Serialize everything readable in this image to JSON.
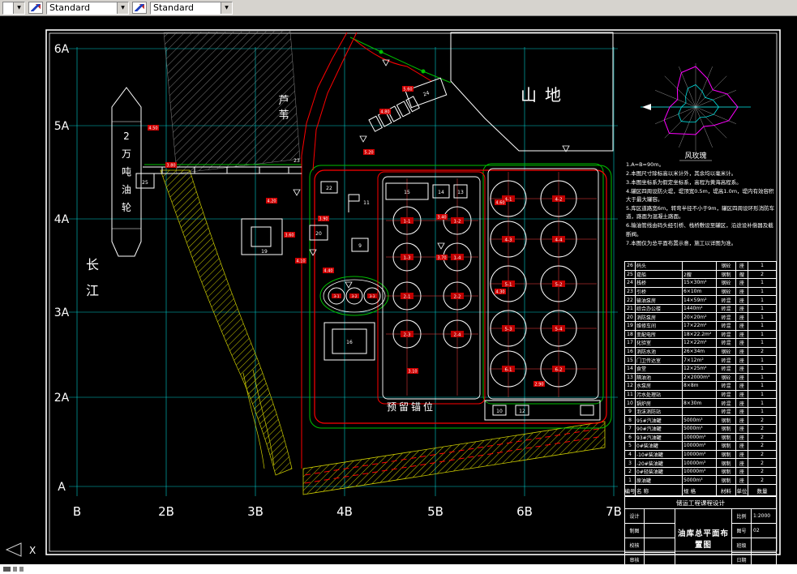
{
  "icons": {
    "dropdown": "▼"
  },
  "toolbar": {
    "combo1": "Standard",
    "combo2": "Standard"
  },
  "grid": {
    "rows": [
      "6A",
      "5A",
      "4A",
      "3A",
      "2A",
      "A"
    ],
    "cols": [
      "B",
      "2B",
      "3B",
      "4B",
      "5B",
      "6B",
      "7B"
    ]
  },
  "plan": {
    "river": [
      "长",
      "江"
    ],
    "ship": [
      "2",
      "万",
      "吨",
      "油",
      "轮"
    ],
    "reeds": [
      "芦",
      "苇"
    ],
    "mountain": "山地",
    "reserved": "预留锚位",
    "windrose_title": "风玫瑰",
    "buildings": {
      "n25": "25",
      "n24": "24",
      "n23": "23",
      "n22": "22",
      "n20": "20",
      "n19": "19",
      "n16": "16",
      "n15": "15",
      "n14": "14",
      "n13": "13",
      "n12": "12",
      "n11": "11",
      "n10": "10",
      "n9": "9"
    },
    "tanks_right": [
      "4-1",
      "4-2",
      "4-3",
      "4-4",
      "5-1",
      "5-2",
      "5-3",
      "5-4",
      "6-1",
      "6-2"
    ],
    "tanks_mid": [
      "1-1",
      "1-2",
      "1-3",
      "1-4",
      "2-1",
      "2-2",
      "2-3",
      "2-4"
    ],
    "tanks_small": [
      "3-1",
      "3-2",
      "3-3"
    ],
    "dims": [
      "4.50",
      "3.80",
      "4.20",
      "3.60",
      "4.10",
      "3.90",
      "4.40",
      "5.20",
      "4.80",
      "5.60",
      "3.40",
      "3.70",
      "4.60",
      "4.30",
      "2.90",
      "3.10"
    ]
  },
  "notes": {
    "lines": [
      "1.A=B=90m。",
      "2.本图尺寸除标高以米计外，其余均以毫米计。",
      "3.本图坐标系为假定坐标系，高程为黄海高程系。",
      "4.罐区四周设防火堤，堤顶宽0.5m，堤高1.0m，堤内有效容积大于最大罐容。",
      "5.库区道路宽6m，转弯半径不小于9m，罐区四周设环形消防车道，路面为混凝土路面。",
      "6.输油管线由码头经引桥、栈桥敷设至罐区，沿途设补偿器及截断阀。",
      "7.本图仅为总平面布置示意，施工以详图为准。"
    ]
  },
  "table": {
    "headers": [
      "编号",
      "名 称",
      "规 格",
      "材料",
      "单位",
      "数量"
    ],
    "rows": [
      [
        "26",
        "码头",
        "",
        "钢砼",
        "座",
        "1"
      ],
      [
        "25",
        "趸船",
        "2艘",
        "钢制",
        "艘",
        "2"
      ],
      [
        "24",
        "栈桥",
        "15×30m²",
        "钢砼",
        "座",
        "1"
      ],
      [
        "23",
        "引桥",
        "6×10m",
        "钢砼",
        "座",
        "1"
      ],
      [
        "22",
        "输油泵房",
        "14×59m²",
        "砖混",
        "座",
        "1"
      ],
      [
        "21",
        "综合办公楼",
        "1440m²",
        "砖混",
        "座",
        "1"
      ],
      [
        "20",
        "消防泵房",
        "20×20m²",
        "砖混",
        "座",
        "1"
      ],
      [
        "19",
        "维修车间",
        "17×22m²",
        "砖混",
        "座",
        "1"
      ],
      [
        "18",
        "变配电所",
        "18×22.2m²",
        "砖混",
        "座",
        "1"
      ],
      [
        "17",
        "化验室",
        "12×22m²",
        "砖混",
        "座",
        "1"
      ],
      [
        "16",
        "消防水池",
        "26×34m",
        "钢砼",
        "座",
        "2"
      ],
      [
        "15",
        "门卫传达室",
        "7×12m²",
        "砖混",
        "座",
        "1"
      ],
      [
        "14",
        "食堂",
        "12×25m²",
        "砖混",
        "座",
        "1"
      ],
      [
        "13",
        "隔油池",
        "2×2000m³",
        "钢砼",
        "座",
        "1"
      ],
      [
        "12",
        "水泵房",
        "8×8m",
        "砖混",
        "座",
        "1"
      ],
      [
        "11",
        "污水处理站",
        "",
        "砖混",
        "座",
        "1"
      ],
      [
        "10",
        "锅炉房",
        "8×30m",
        "砖混",
        "座",
        "1"
      ],
      [
        "9",
        "泡沫消防站",
        "",
        "砖混",
        "座",
        "1"
      ],
      [
        "8",
        "95#汽油罐",
        "5000m³",
        "钢制",
        "座",
        "2"
      ],
      [
        "7",
        "90#汽油罐",
        "5000m³",
        "钢制",
        "座",
        "2"
      ],
      [
        "6",
        "93#汽油罐",
        "10000m³",
        "钢制",
        "座",
        "2"
      ],
      [
        "5",
        "0#柴油罐",
        "10000m³",
        "钢制",
        "座",
        "2"
      ],
      [
        "4",
        "-10#柴油罐",
        "10000m³",
        "钢制",
        "座",
        "2"
      ],
      [
        "3",
        "-20#柴油罐",
        "10000m³",
        "钢制",
        "座",
        "2"
      ],
      [
        "2",
        "0#轻柴油罐",
        "10000m³",
        "钢制",
        "座",
        "2"
      ],
      [
        "1",
        "原油罐",
        "5000m³",
        "钢制",
        "座",
        "2"
      ]
    ]
  },
  "titleblock": {
    "project": "储运工程课程设计",
    "title": "油库总平面布置图",
    "fields": [
      {
        "label": "设计",
        "value": ""
      },
      {
        "label": "制图",
        "value": ""
      },
      {
        "label": "校核",
        "value": ""
      },
      {
        "label": "审核",
        "value": ""
      }
    ],
    "right": [
      {
        "label": "比例",
        "value": "1:2000"
      },
      {
        "label": "图号",
        "value": "02"
      },
      {
        "label": "班级",
        "value": ""
      },
      {
        "label": "日期",
        "value": ""
      }
    ]
  }
}
